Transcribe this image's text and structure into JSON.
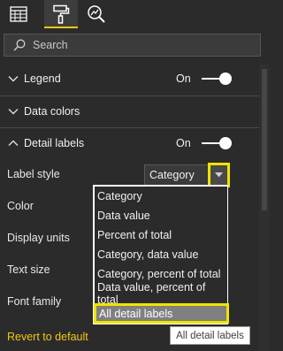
{
  "tabs": [
    {
      "icon": "fields-icon"
    },
    {
      "icon": "format-paint-roller-icon"
    },
    {
      "icon": "analytics-magnifier-icon"
    }
  ],
  "search": {
    "placeholder": "Search",
    "icon": "search-icon"
  },
  "sections": {
    "legend": {
      "label": "Legend",
      "toggle": "On",
      "expanded": false
    },
    "data_colors": {
      "label": "Data colors",
      "expanded": false
    },
    "detail_labels": {
      "label": "Detail labels",
      "toggle": "On",
      "expanded": true
    }
  },
  "props": {
    "label_style": "Label style",
    "color": "Color",
    "display_units": "Display units",
    "text_size": "Text size",
    "font_family": "Font family"
  },
  "label_style_select": {
    "value": "Category"
  },
  "dropdown_options": [
    "Category",
    "Data value",
    "Percent of total",
    "Category, data value",
    "Category, percent of total",
    "Data value, percent of total",
    "All detail labels"
  ],
  "highlighted_option": "All detail labels",
  "revert": "Revert to default",
  "tooltip": "All detail labels",
  "colors": {
    "accent": "#f2c811",
    "highlight_border": "#f2e200",
    "panel": "#2b2b2b"
  }
}
